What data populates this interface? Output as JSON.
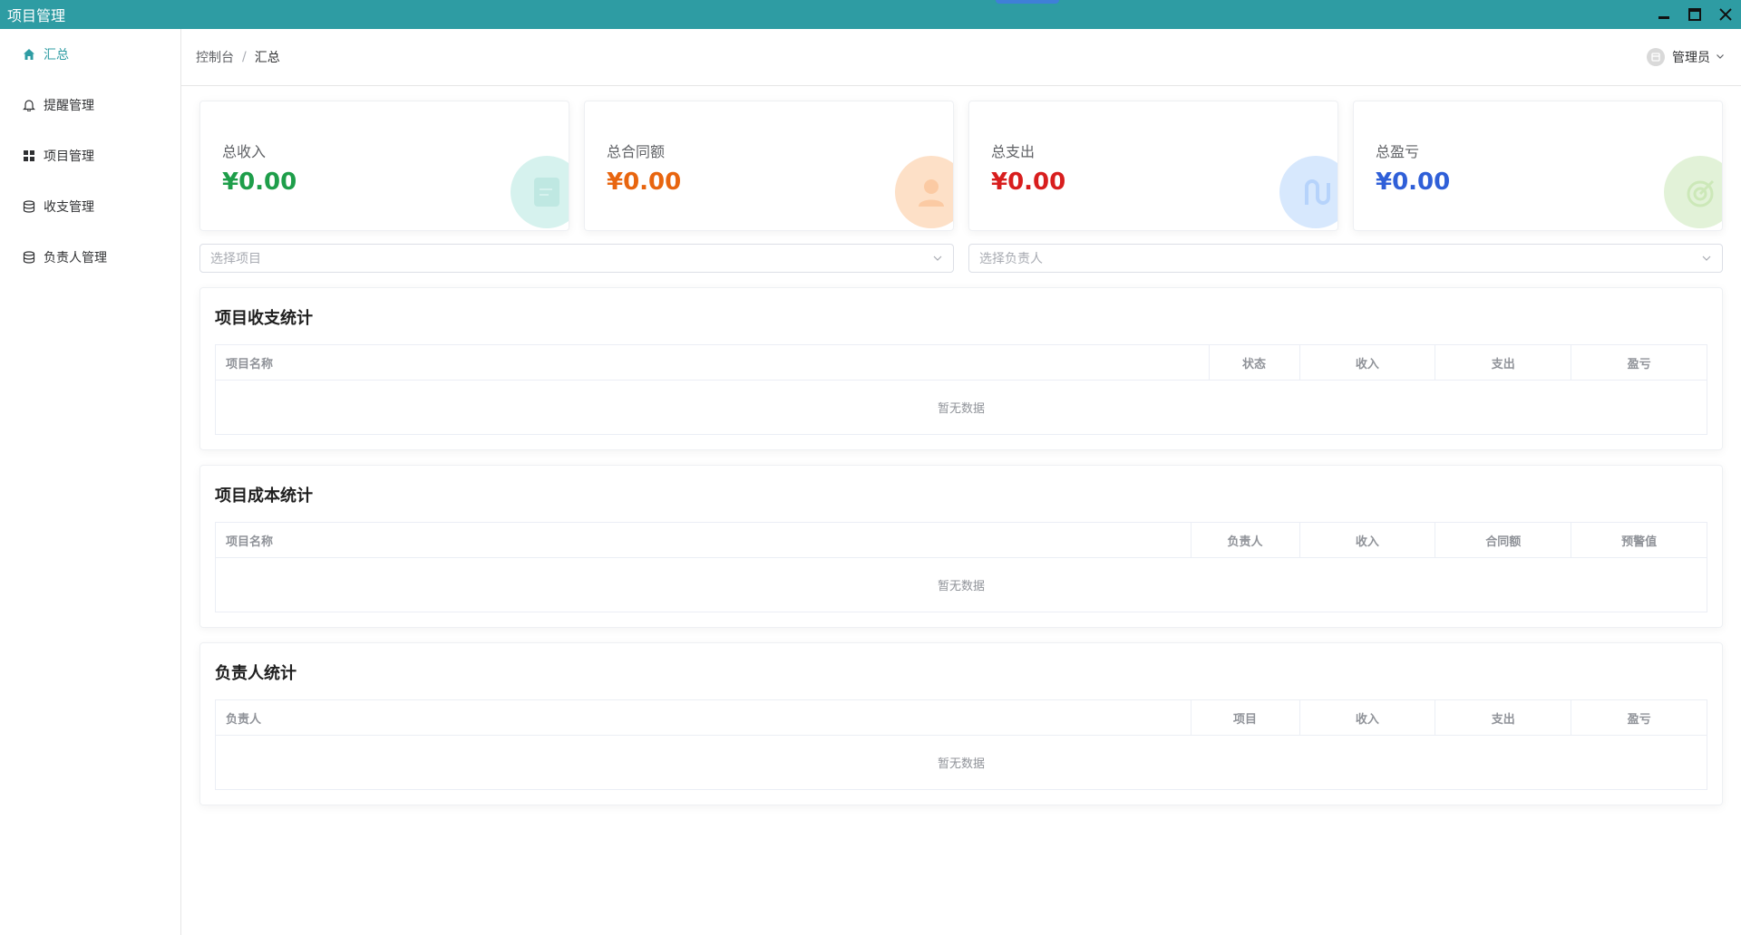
{
  "window": {
    "title": "项目管理"
  },
  "colors": {
    "accent": "#2e9ca3",
    "income": "#1e9e4a",
    "contract": "#e8650f",
    "expense": "#d81e1e",
    "profit": "#2f5fd8"
  },
  "sidebar": {
    "items": [
      {
        "label": "汇总",
        "icon": "home-icon",
        "active": true
      },
      {
        "label": "提醒管理",
        "icon": "bell-icon"
      },
      {
        "label": "项目管理",
        "icon": "grid-icon"
      },
      {
        "label": "收支管理",
        "icon": "database-icon"
      },
      {
        "label": "负责人管理",
        "icon": "database-icon"
      }
    ]
  },
  "header": {
    "breadcrumb": [
      "控制台",
      "汇总"
    ],
    "user": "管理员"
  },
  "stats": [
    {
      "label": "总收入",
      "value": "¥0.00",
      "icon": "wallet-icon"
    },
    {
      "label": "总合同额",
      "value": "¥0.00",
      "icon": "user-icon"
    },
    {
      "label": "总支出",
      "value": "¥0.00",
      "icon": "route-icon"
    },
    {
      "label": "总盈亏",
      "value": "¥0.00",
      "icon": "target-icon"
    }
  ],
  "filters": {
    "project_placeholder": "选择项目",
    "owner_placeholder": "选择负责人"
  },
  "tables": [
    {
      "title": "项目收支统计",
      "columns": [
        "项目名称",
        "状态",
        "收入",
        "支出",
        "盈亏"
      ],
      "empty": "暂无数据"
    },
    {
      "title": "项目成本统计",
      "columns": [
        "项目名称",
        "负责人",
        "收入",
        "合同额",
        "预警值"
      ],
      "empty": "暂无数据"
    },
    {
      "title": "负责人统计",
      "columns": [
        "负责人",
        "项目",
        "收入",
        "支出",
        "盈亏"
      ],
      "empty": "暂无数据"
    }
  ]
}
